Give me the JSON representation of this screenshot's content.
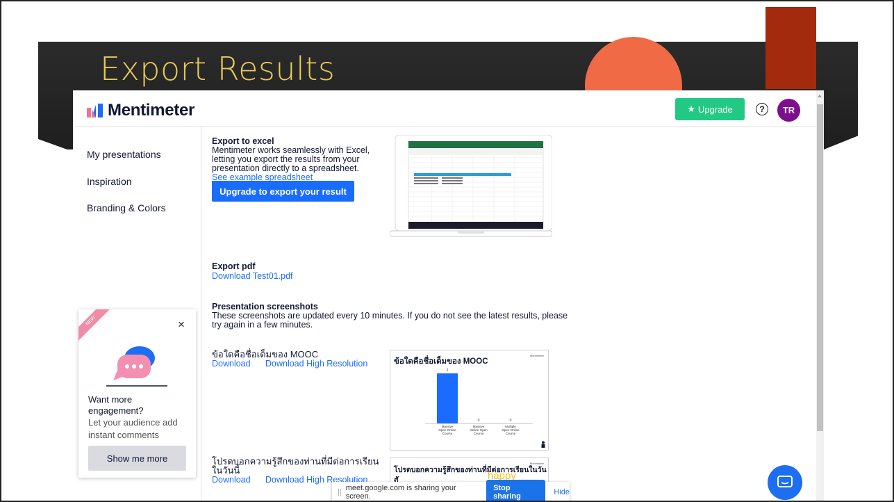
{
  "slide": {
    "title": "Export Results"
  },
  "app": {
    "logo_text": "Mentimeter",
    "upgrade_label": "Upgrade",
    "help_symbol": "?",
    "avatar_initials": "TR",
    "colors": {
      "upgrade": "#22c984",
      "primary": "#196cff",
      "avatar": "#7d0f8f"
    }
  },
  "sidebar": {
    "items": [
      {
        "label": "My presentations"
      },
      {
        "label": "Inspiration"
      },
      {
        "label": "Branding & Colors"
      }
    ]
  },
  "excel": {
    "title": "Export to excel",
    "lines": [
      "Mentimeter works seamlessly with Excel,",
      "letting you export the results from your",
      "presentation directly to a spreadsheet."
    ],
    "link": "See example spreadsheet",
    "button": "Upgrade to export your result"
  },
  "pdf": {
    "title": "Export pdf",
    "link": "Download Test01.pdf"
  },
  "screenshots": {
    "title": "Presentation screenshots",
    "lines": [
      "These screenshots are updated every 10 minutes. If you do not see the latest results, please",
      "try again in a few minutes."
    ],
    "items": [
      {
        "name": "ข้อใดคือชื่อเต็มของ MOOC",
        "download": "Download",
        "download_hr": "Download High Resolution",
        "thumb_title": "ข้อใดคือชื่อเต็มของ MOOC",
        "thumb_brand": "Mentimeter",
        "chart_data": {
          "type": "bar",
          "categories": [
            "Massive Open Online Course",
            "Massive Online Open Course",
            "Multiple Open Online Course"
          ],
          "values": [
            2,
            0,
            0
          ]
        }
      },
      {
        "name_line1": "โปรดบอกความรู้สึกของท่านที่มีต่อการเรียน",
        "name_line2": "ในวันนี้",
        "download": "Download",
        "download_hr": "Download High Resolution",
        "thumb_title": "โปรดบอกความรู้สึกของท่านที่มีต่อการเรียนในวันนี้",
        "thumb_brand": "Mentimeter",
        "thumb_word": "happy"
      }
    ]
  },
  "popup": {
    "badge": "NEW",
    "close": "×",
    "headline_1": "Want more",
    "headline_2": "engagement?",
    "body_1": "Let your audience add",
    "body_2": "instant comments",
    "button": "Show me more"
  },
  "share_bar": {
    "message": "meet.google.com is sharing your screen.",
    "stop": "Stop sharing",
    "hide": "Hide"
  }
}
